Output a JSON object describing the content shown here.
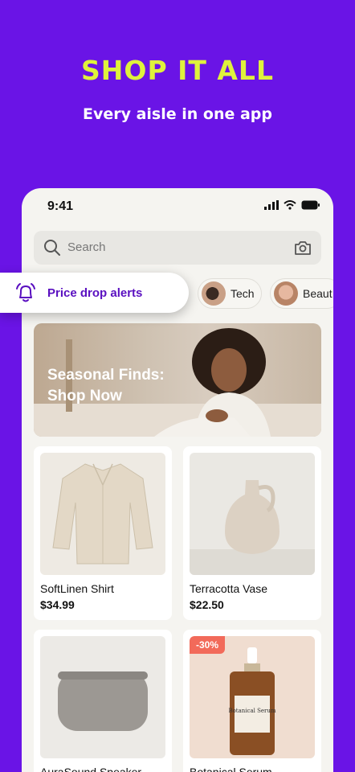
{
  "promo": {
    "headline": "SHOP IT ALL",
    "subline": "Every aisle in one app"
  },
  "status_bar": {
    "time": "9:41",
    "icons": [
      "signal-icon",
      "wifi-icon",
      "battery-icon"
    ]
  },
  "search": {
    "placeholder": "Search",
    "icon": "search-icon",
    "camera_icon": "camera-icon"
  },
  "categories": [
    {
      "label": "Tech"
    },
    {
      "label": "Beaut"
    }
  ],
  "alert": {
    "label": "Price drop alerts",
    "icon": "bell-icon"
  },
  "banner": {
    "title": "Seasonal Finds: Shop Now"
  },
  "products": [
    {
      "name": "SoftLinen Shirt",
      "price": "$34.99"
    },
    {
      "name": "Terracotta Vase",
      "price": "$22.50"
    },
    {
      "name": "AuraSound Speaker",
      "price": ""
    },
    {
      "name": "Botanical Serum",
      "price": "",
      "badge": "-30%",
      "label_text": "Botanical Serum"
    }
  ],
  "colors": {
    "background": "#6a14e6",
    "headline": "#dff23c",
    "accent": "#5a10c0",
    "discount": "#f26a5a"
  }
}
